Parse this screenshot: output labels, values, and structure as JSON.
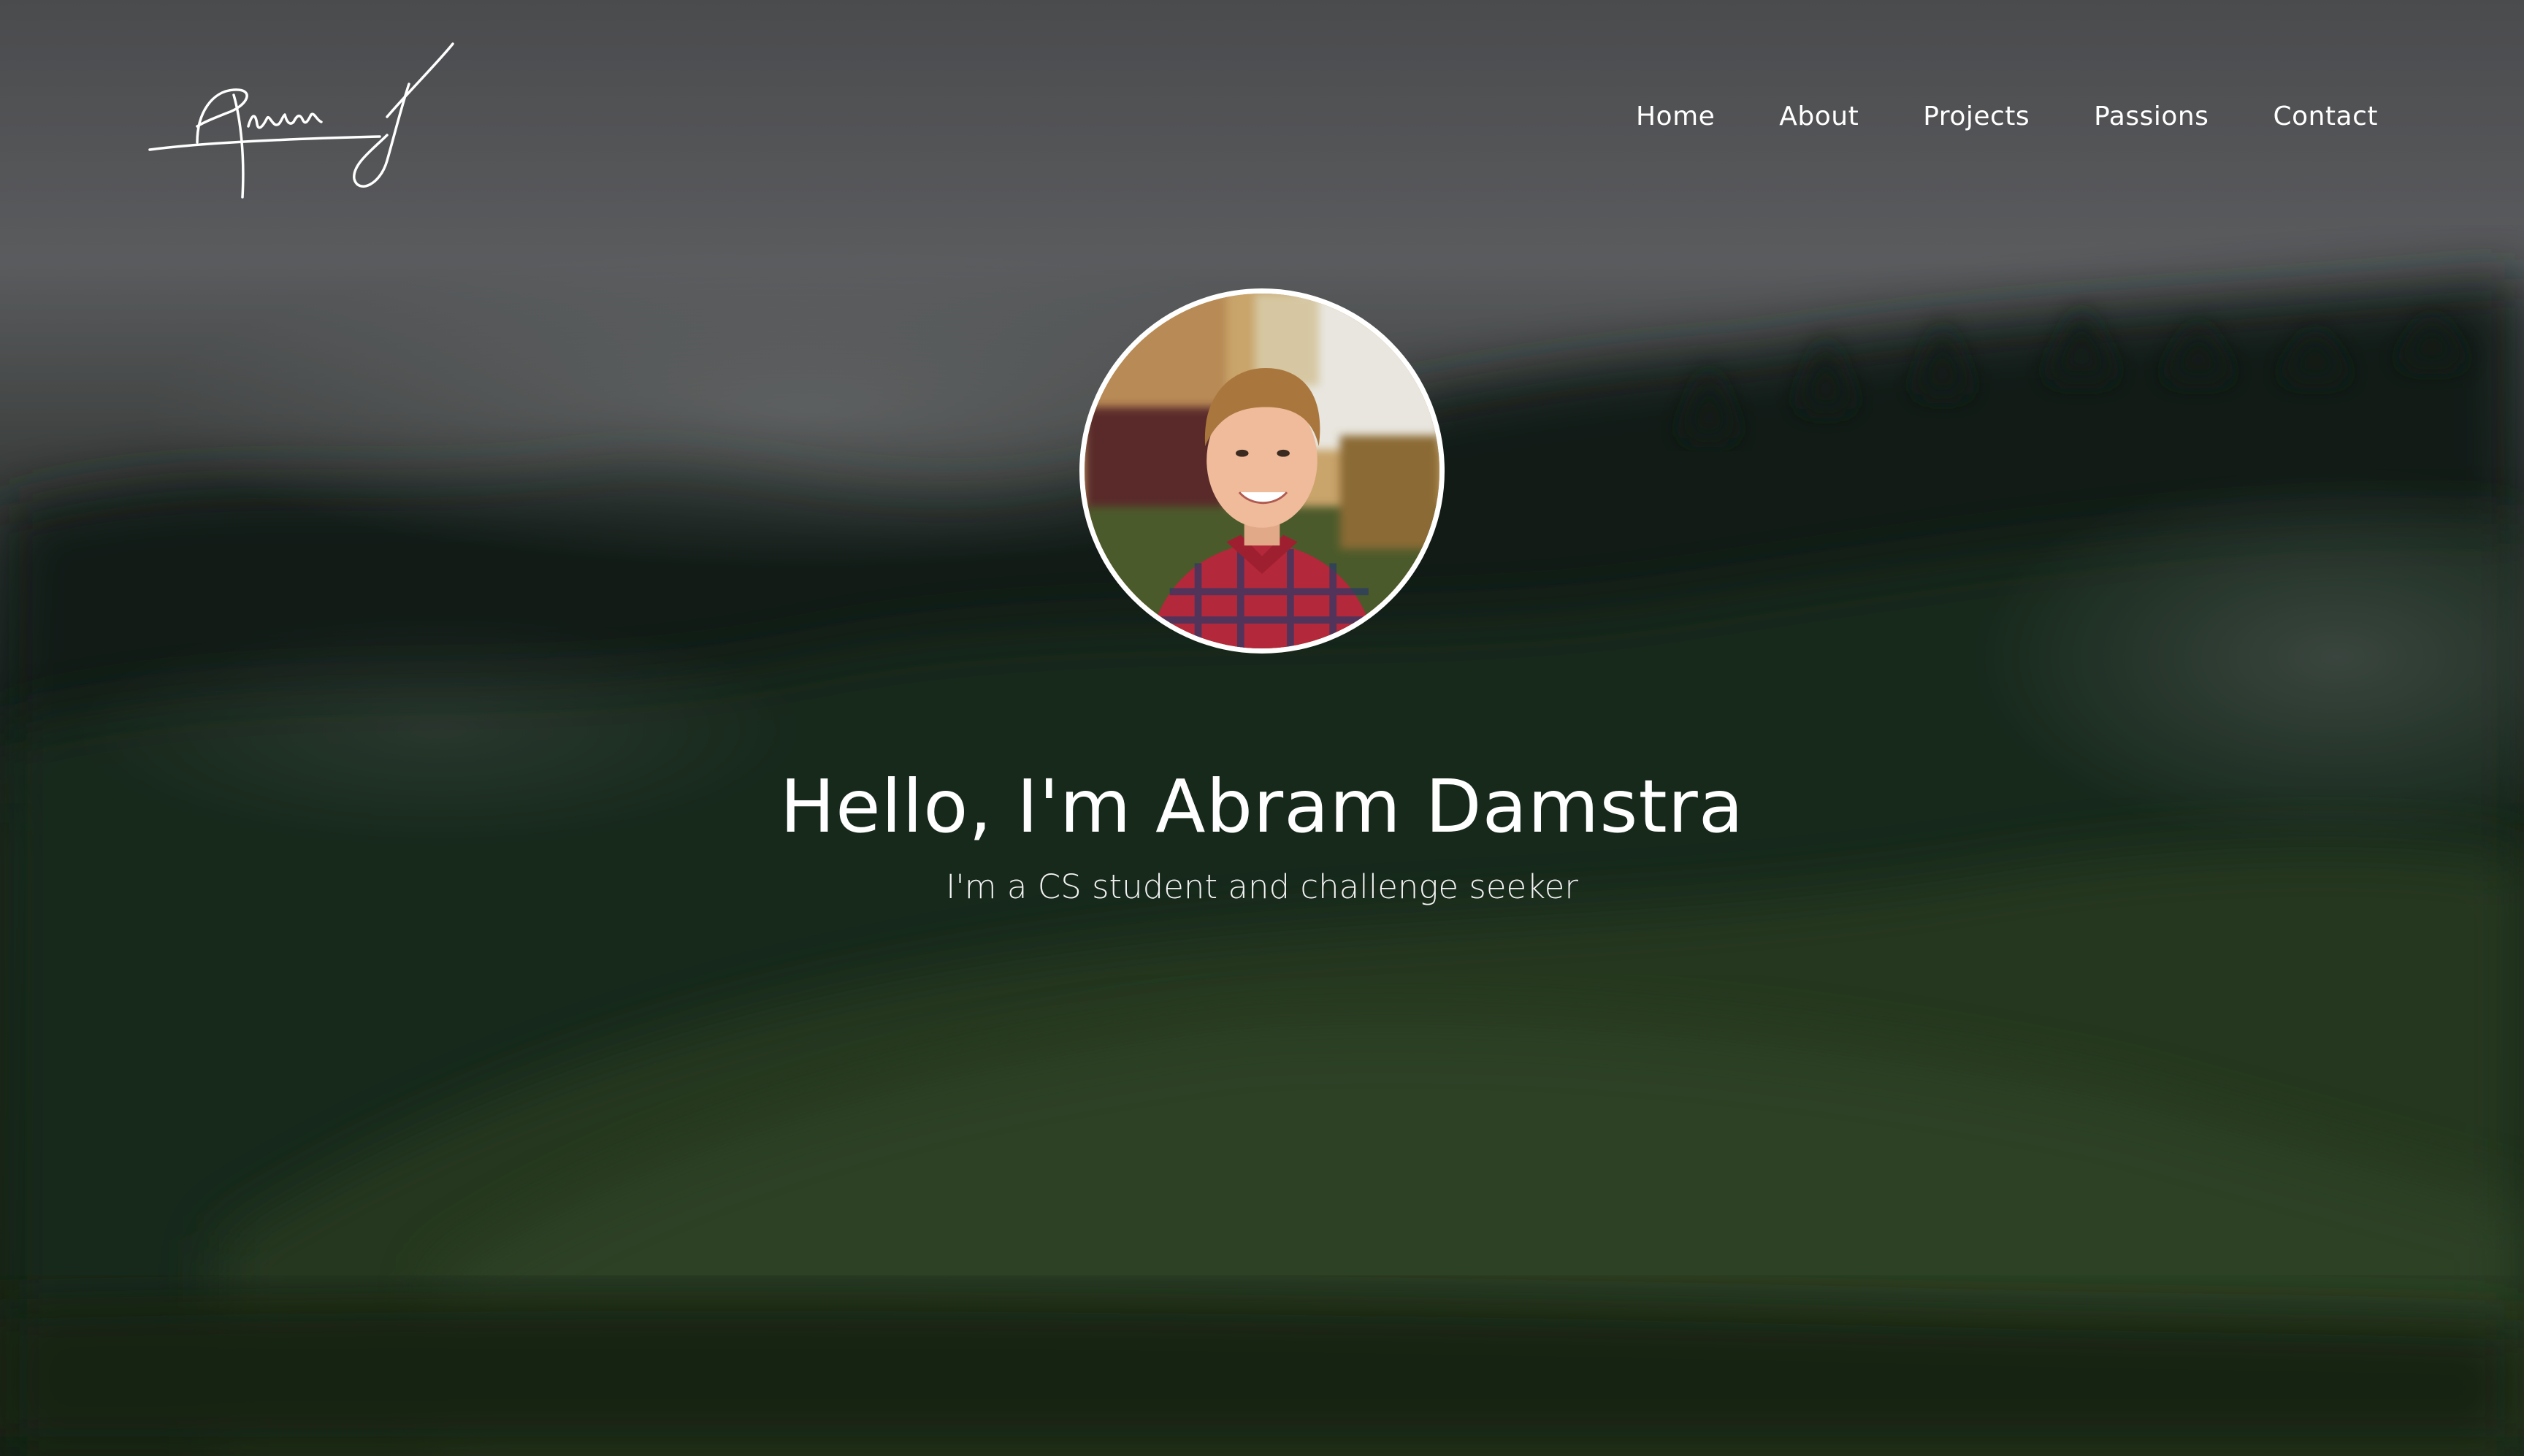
{
  "nav": {
    "logo_alt": "Abram signature",
    "items": [
      {
        "label": "Home"
      },
      {
        "label": "About"
      },
      {
        "label": "Projects"
      },
      {
        "label": "Passions"
      },
      {
        "label": "Contact"
      }
    ]
  },
  "hero": {
    "title": "Hello, I'm Abram Damstra",
    "subtitle": "I'm a CS student and challenge seeker"
  },
  "colors": {
    "text": "#ffffff",
    "background_sky": "#6b6d70",
    "background_forest": "#1c2a1a",
    "avatar_border": "#ffffff"
  },
  "icons": [
    "signature-logo",
    "profile-photo"
  ]
}
